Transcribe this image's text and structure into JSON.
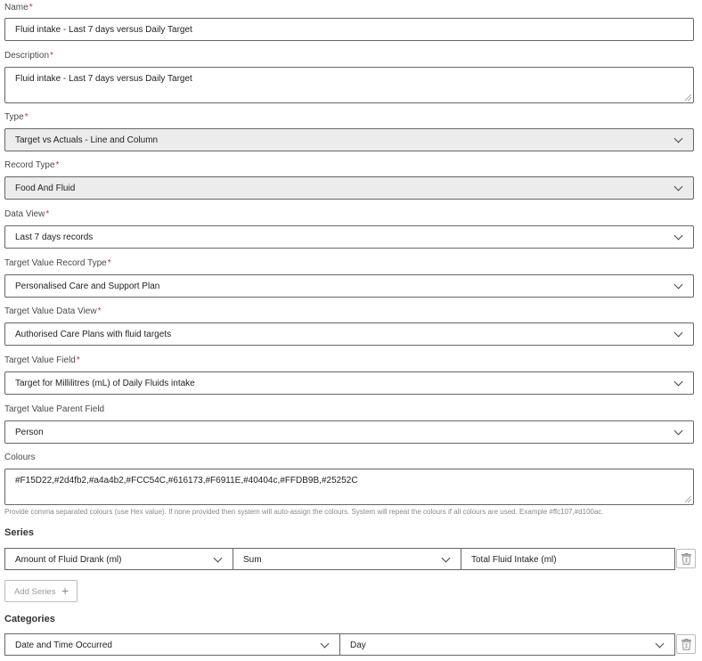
{
  "fields": {
    "name": {
      "label": "Name",
      "required": "*",
      "value": "Fluid intake - Last 7 days versus Daily Target"
    },
    "description": {
      "label": "Description",
      "required": "*",
      "value": "Fluid intake - Last 7 days versus Daily Target"
    },
    "type": {
      "label": "Type",
      "required": "*",
      "value": "Target vs Actuals - Line and Column"
    },
    "record_type": {
      "label": "Record Type",
      "required": "*",
      "value": "Food And Fluid"
    },
    "data_view": {
      "label": "Data View",
      "required": "*",
      "value": "Last 7 days records"
    },
    "target_record_type": {
      "label": "Target Value Record Type",
      "required": "*",
      "value": "Personalised Care and Support Plan"
    },
    "target_data_view": {
      "label": "Target Value Data View",
      "required": "*",
      "value": "Authorised Care Plans with fluid targets"
    },
    "target_field": {
      "label": "Target Value Field",
      "required": "*",
      "value": "Target for Millilitres (mL) of Daily Fluids intake"
    },
    "target_parent_field": {
      "label": "Target Value Parent Field",
      "value": "Person"
    },
    "colours": {
      "label": "Colours",
      "value": "#F15D22,#2d4fb2,#a4a4b2,#FCC54C,#616173,#F6911E,#40404c,#FFDB9B,#25252C",
      "help": "Provide comma separated colours (use Hex value). If none provided then system will auto-assign the colours. System will repeat the colours if all colours are used. Example #ffc107,#d100ac."
    }
  },
  "series": {
    "heading": "Series",
    "rows": [
      {
        "field": "Amount of Fluid Drank (ml)",
        "aggregate": "Sum",
        "name": "Total Fluid Intake (ml)"
      }
    ],
    "add_label": "Add Series",
    "add_icon": "plus-icon",
    "delete_icon": "trash-icon"
  },
  "categories": {
    "heading": "Categories",
    "rows": [
      {
        "field": "Date and Time Occurred",
        "grouping": "Day"
      }
    ],
    "delete_icon": "trash-icon"
  },
  "colors": {
    "required_star": "#c0392b",
    "disabled_bg": "#ececec",
    "border": "#666666"
  }
}
